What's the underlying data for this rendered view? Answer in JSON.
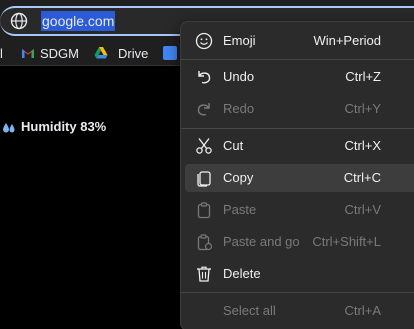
{
  "address_bar": {
    "url": "google.com"
  },
  "bookmarks": [
    {
      "label": "SDGM",
      "icon": "gmail-icon"
    },
    {
      "label": "Drive",
      "icon": "drive-icon"
    }
  ],
  "bookmark_partial": "l",
  "weather": {
    "text": "Humidity 83%"
  },
  "context_menu": {
    "items": [
      {
        "label": "Emoji",
        "shortcut": "Win+Period",
        "icon": "emoji-icon",
        "enabled": true
      },
      {
        "label": "Undo",
        "shortcut": "Ctrl+Z",
        "icon": "undo-icon",
        "enabled": true
      },
      {
        "label": "Redo",
        "shortcut": "Ctrl+Y",
        "icon": "redo-icon",
        "enabled": false
      },
      {
        "label": "Cut",
        "shortcut": "Ctrl+X",
        "icon": "cut-icon",
        "enabled": true
      },
      {
        "label": "Copy",
        "shortcut": "Ctrl+C",
        "icon": "copy-icon",
        "enabled": true,
        "hovered": true
      },
      {
        "label": "Paste",
        "shortcut": "Ctrl+V",
        "icon": "paste-icon",
        "enabled": false
      },
      {
        "label": "Paste and go",
        "shortcut": "Ctrl+Shift+L",
        "icon": "paste-and-go-icon",
        "enabled": false
      },
      {
        "label": "Delete",
        "shortcut": "",
        "icon": "delete-icon",
        "enabled": true
      },
      {
        "label": "Select all",
        "shortcut": "Ctrl+A",
        "icon": "",
        "enabled": false
      }
    ]
  },
  "colors": {
    "url_highlight": "#2b5bd6",
    "address_border": "#a8c7fa",
    "menu_bg": "#2b2b2b",
    "hover_bg": "#3d3d3d",
    "disabled_text": "#7a7a7a"
  }
}
